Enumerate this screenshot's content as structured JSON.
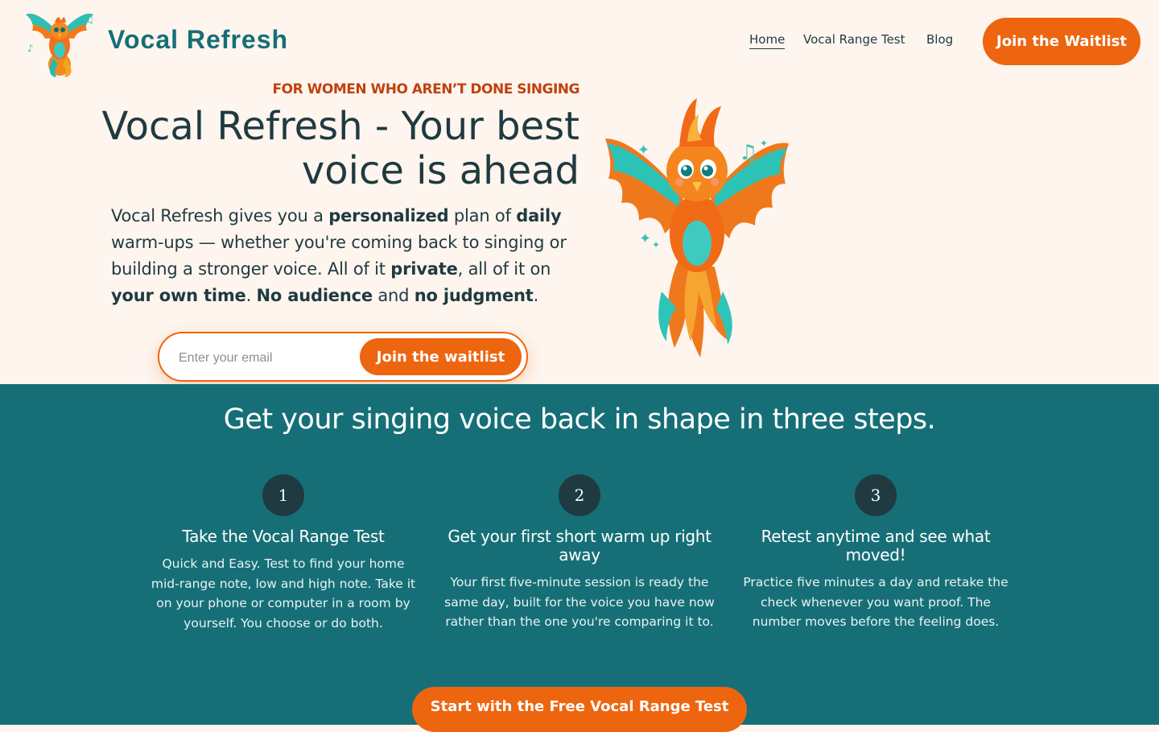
{
  "header": {
    "brand": "Vocal Refresh",
    "nav": [
      {
        "label": "Home"
      },
      {
        "label": "Vocal Range Test"
      },
      {
        "label": "Blog"
      }
    ],
    "cta_label": "Join the Waitlist",
    "logo_icon": "phoenix-logo-icon"
  },
  "hero": {
    "eyebrow": "FOR WOMEN WHO AREN’T DONE SINGING",
    "title": "Vocal Refresh - Your best voice is ahead",
    "description": {
      "t1": "Vocal Refresh gives you a ",
      "b1": "personalized",
      "t2": " plan of ",
      "b2": "daily",
      "t3": " warm-ups — whether you're coming back to singing or building a stronger voice. All of it ",
      "b3": "private",
      "t4": ", all of it on ",
      "b4": "your own time",
      "t5": ". ",
      "b5": "No audience",
      "t6": " and ",
      "b6": "no judgment",
      "t7": "."
    },
    "email_placeholder": "Enter your email",
    "email_value": "",
    "submit_label": "Join the waitlist",
    "illustration_icon": "phoenix-mascot-icon"
  },
  "steps": {
    "title": "Get your singing voice back in shape in three steps.",
    "items": [
      {
        "number": "1",
        "title": "Take the Vocal Range Test",
        "description": "Quick and Easy. Test to find your home mid-range note, low and high note. Take it on your phone or computer in a room by yourself. You choose or do both."
      },
      {
        "number": "2",
        "title": "Get your first short warm up right away",
        "description": "Your first five-minute session is ready the same day, built for the voice you have now rather than the one you're comparing it to."
      },
      {
        "number": "3",
        "title": "Retest anytime and see what moved!",
        "description": "Practice five minutes a day and retake the check whenever you want proof. The number moves before the feeling does."
      }
    ],
    "cta_label": "Start with the Free Vocal Range Test"
  },
  "colors": {
    "background": "#fdf5ee",
    "teal": "#166f77",
    "orange": "#ee6510",
    "eyebrow": "#c0420d",
    "text": "#1f3a40"
  }
}
